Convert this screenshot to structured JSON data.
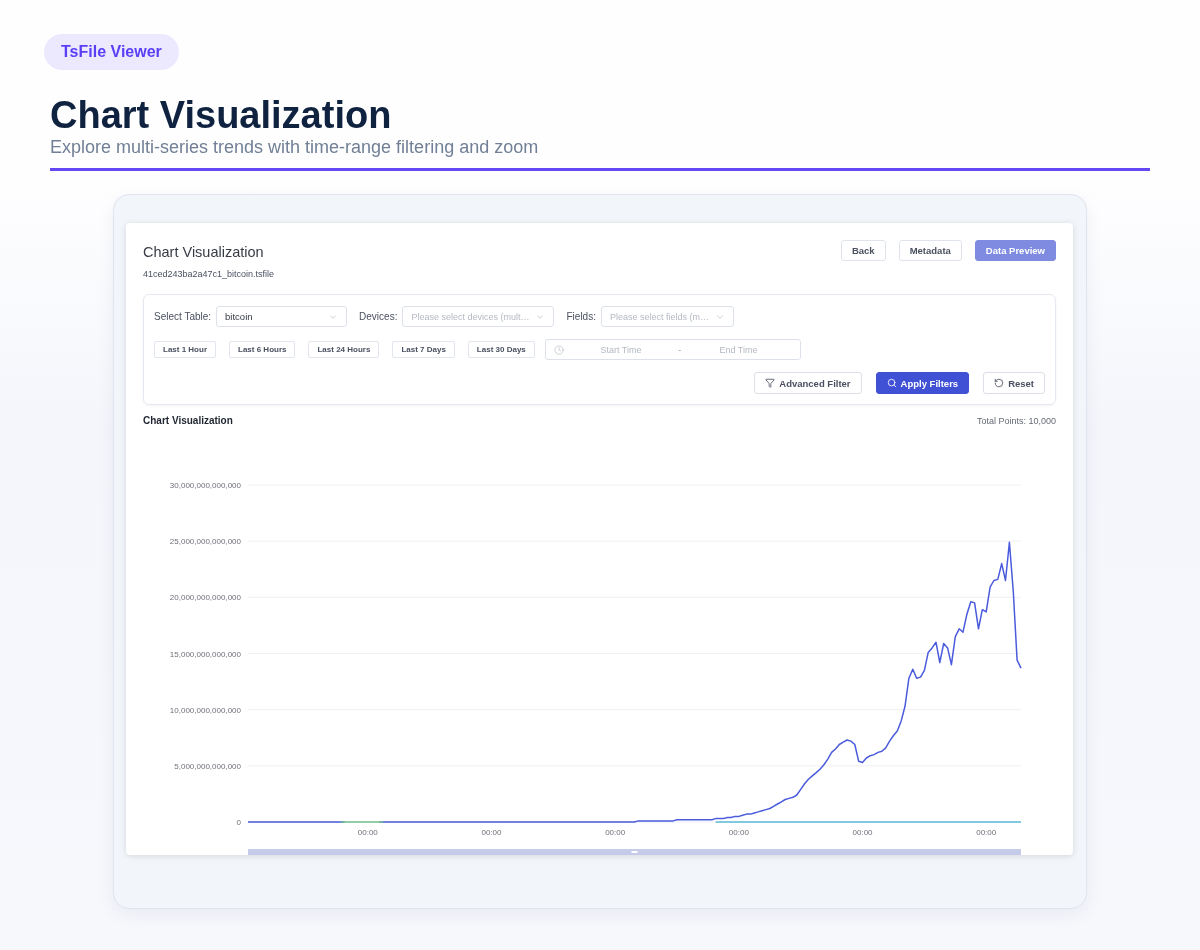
{
  "header": {
    "badge": "TsFile Viewer",
    "title": "Chart Visualization",
    "subtitle": "Explore multi-series trends with time-range filtering and zoom"
  },
  "card": {
    "title": "Chart Visualization",
    "file_name": "41ced243ba2a47c1_bitcoin.tsfile",
    "buttons": [
      {
        "label": "Back",
        "kind": "default"
      },
      {
        "label": "Metadata",
        "kind": "default"
      },
      {
        "label": "Data Preview",
        "kind": "accent"
      }
    ]
  },
  "filters": {
    "selects": [
      {
        "label": "Select Table:",
        "value": "bitcoin"
      },
      {
        "label": "Devices:",
        "placeholder": "Please select devices (mult…"
      },
      {
        "label": "Fields:",
        "placeholder": "Please select fields (m…"
      }
    ],
    "quick_ranges": [
      "Last 1 Hour",
      "Last 6 Hours",
      "Last 24 Hours",
      "Last 7 Days",
      "Last 30 Days"
    ],
    "time_range": {
      "start_placeholder": "Start Time",
      "separator": "-",
      "end_placeholder": "End Time"
    },
    "actions": [
      {
        "label": "Advanced Filter",
        "kind": "filter"
      },
      {
        "label": "Apply Filters",
        "kind": "apply"
      },
      {
        "label": "Reset",
        "kind": "reset"
      }
    ]
  },
  "chart": {
    "heading": "Chart Visualization",
    "total_points": "Total Points: 10,000",
    "chart_data": {
      "type": "line",
      "grid": true,
      "ylim": [
        0,
        30000000000000.0
      ],
      "categories": [
        null,
        null,
        null,
        null,
        null,
        null,
        null,
        null,
        null,
        null,
        null,
        null,
        null,
        null,
        null,
        null,
        null,
        null,
        null,
        null,
        null,
        null,
        null,
        null,
        null,
        null,
        null,
        null,
        null,
        null,
        null,
        "00:00",
        null,
        null,
        null,
        null,
        null,
        null,
        null,
        null,
        null,
        null,
        null,
        null,
        null,
        null,
        null,
        null,
        null,
        null,
        null,
        null,
        null,
        null,
        null,
        null,
        null,
        null,
        null,
        null,
        null,
        null,
        null,
        "00:00",
        null,
        null,
        null,
        null,
        null,
        null,
        null,
        null,
        null,
        null,
        null,
        null,
        null,
        null,
        null,
        null,
        null,
        null,
        null,
        null,
        null,
        null,
        null,
        null,
        null,
        null,
        null,
        null,
        null,
        null,
        null,
        "00:00",
        null,
        null,
        null,
        null,
        null,
        null,
        null,
        null,
        null,
        null,
        null,
        null,
        null,
        null,
        null,
        null,
        null,
        null,
        null,
        null,
        null,
        null,
        null,
        null,
        null,
        null,
        null,
        null,
        null,
        null,
        null,
        "00:00",
        null,
        null,
        null,
        null,
        null,
        null,
        null,
        null,
        null,
        null,
        null,
        null,
        null,
        null,
        null,
        null,
        null,
        null,
        null,
        null,
        null,
        null,
        null,
        null,
        null,
        null,
        null,
        null,
        null,
        null,
        null,
        "00:00",
        null,
        null,
        null,
        null,
        null,
        null,
        null,
        null,
        null,
        null,
        null,
        null,
        null,
        null,
        null,
        null,
        null,
        null,
        null,
        null,
        null,
        null,
        null,
        null,
        null,
        null,
        null,
        null,
        null,
        null,
        null,
        "00:00",
        null,
        null,
        null,
        null,
        null,
        null,
        null,
        null,
        null
      ],
      "yticks": [
        {
          "value": 0,
          "label": "0"
        },
        {
          "value": 5000000000000.0,
          "label": "5,000,000,000,000"
        },
        {
          "value": 10000000000000.0,
          "label": "10,000,000,000,000"
        },
        {
          "value": 15000000000000.0,
          "label": "15,000,000,000,000"
        },
        {
          "value": 20000000000000.0,
          "label": "20,000,000,000,000"
        },
        {
          "value": 25000000000000.0,
          "label": "25,000,000,000,000"
        },
        {
          "value": 30000000000000.0,
          "label": "30,000,000,000,000"
        }
      ],
      "series": [
        {
          "color": "#5bb8d6",
          "values": [
            null,
            null,
            null,
            null,
            null,
            null,
            null,
            null,
            null,
            null,
            null,
            null,
            null,
            null,
            null,
            null,
            null,
            null,
            null,
            null,
            null,
            null,
            null,
            null,
            null,
            null,
            null,
            null,
            null,
            null,
            null,
            null,
            null,
            null,
            null,
            null,
            null,
            null,
            null,
            null,
            null,
            null,
            null,
            null,
            null,
            null,
            null,
            null,
            null,
            null,
            null,
            null,
            null,
            null,
            null,
            null,
            null,
            null,
            null,
            null,
            null,
            null,
            null,
            null,
            null,
            null,
            null,
            null,
            null,
            null,
            null,
            null,
            null,
            null,
            null,
            null,
            null,
            null,
            null,
            null,
            null,
            null,
            null,
            null,
            null,
            null,
            null,
            null,
            null,
            null,
            null,
            null,
            null,
            null,
            null,
            null,
            null,
            null,
            null,
            null,
            null,
            null,
            null,
            null,
            null,
            null,
            null,
            null,
            null,
            null,
            null,
            null,
            null,
            null,
            null,
            null,
            null,
            null,
            null,
            null,
            null,
            0,
            0,
            0,
            0,
            0,
            0,
            0,
            0,
            0,
            0,
            0,
            0,
            0,
            0,
            0,
            0,
            0,
            0,
            0,
            0,
            0,
            0,
            0,
            0,
            0,
            0,
            0,
            0,
            0,
            0,
            0,
            0,
            0,
            0,
            0,
            0,
            0,
            0,
            0,
            0,
            0,
            0,
            0,
            0,
            0,
            0,
            0,
            0,
            0,
            0,
            0,
            0,
            0,
            0,
            0,
            0,
            0,
            0,
            0,
            0,
            0,
            0,
            0,
            0,
            0,
            0,
            0,
            0,
            0,
            0,
            0,
            0,
            0,
            0,
            0,
            0,
            0,
            0,
            0,
            0
          ]
        },
        {
          "color": "#4a5bdc",
          "values": [
            0,
            0,
            0,
            0,
            0,
            0,
            0,
            0,
            0,
            0,
            0,
            0,
            0,
            0,
            0,
            0,
            0,
            0,
            0,
            0,
            0,
            0,
            0,
            0,
            0,
            0,
            null,
            null,
            null,
            null,
            null,
            null,
            null,
            null,
            0,
            0,
            0,
            0,
            0,
            0,
            0,
            0,
            0,
            0,
            0,
            0,
            0,
            0,
            0,
            0,
            0,
            0,
            0,
            0,
            0,
            0,
            0,
            0,
            0,
            0,
            0,
            0,
            0,
            0,
            0,
            0,
            0,
            0,
            0,
            0,
            0,
            0,
            0,
            0,
            0,
            0,
            0,
            0,
            0,
            0,
            0,
            0,
            0,
            0,
            0,
            0,
            0,
            0,
            0,
            0,
            0,
            0,
            0,
            0,
            0,
            0,
            0,
            0,
            0,
            0,
            0,
            100000000000.0,
            100000000000.0,
            100000000000.0,
            100000000000.0,
            100000000000.0,
            100000000000.0,
            100000000000.0,
            100000000000.0,
            100000000000.0,
            100000000000.0,
            200000000000.0,
            200000000000.0,
            200000000000.0,
            200000000000.0,
            200000000000.0,
            200000000000.0,
            200000000000.0,
            200000000000.0,
            200000000000.0,
            200000000000.0,
            300000000000.0,
            300000000000.0,
            300000000000.0,
            400000000000.0,
            400000000000.0,
            500000000000.0,
            500000000000.0,
            600000000000.0,
            700000000000.0,
            700000000000.0,
            800000000000.0,
            900000000000.0,
            1000000000000.0,
            1100000000000.0,
            1200000000000.0,
            1400000000000.0,
            1600000000000.0,
            1800000000000.0,
            2000000000000.0,
            2100000000000.0,
            2200000000000.0,
            2400000000000.0,
            2900000000000.0,
            3400000000000.0,
            3800000000000.0,
            4100000000000.0,
            4400000000000.0,
            4700000000000.0,
            5100000000000.0,
            5600000000000.0,
            6200000000000.0,
            6500000000000.0,
            6900000000000.0,
            7100000000000.0,
            7300000000000.0,
            7200000000000.0,
            6900000000000.0,
            5400000000000.0,
            5300000000000.0,
            5700000000000.0,
            5900000000000.0,
            6000000000000.0,
            6200000000000.0,
            6300000000000.0,
            6600000000000.0,
            7200000000000.0,
            7700000000000.0,
            8100000000000.0,
            9000000000000.0,
            10300000000000.0,
            12800000000000.0,
            13600000000000.0,
            12800000000000.0,
            12900000000000.0,
            13500000000000.0,
            15100000000000.0,
            15500000000000.0,
            16000000000000.0,
            14200000000000.0,
            15900000000000.0,
            15500000000000.0,
            14000000000000.0,
            16500000000000.0,
            17200000000000.0,
            16900000000000.0,
            18500000000000.0,
            19600000000000.0,
            19500000000000.0,
            17200000000000.0,
            18900000000000.0,
            18700000000000.0,
            20900000000000.0,
            21500000000000.0,
            21600000000000.0,
            23000000000000.0,
            21500000000000.0,
            24900000000000.0,
            20500000000000.0,
            14400000000000.0,
            13700000000000.0
          ]
        },
        {
          "color": "#6cc08b",
          "values": [
            null,
            null,
            null,
            null,
            null,
            null,
            null,
            null,
            null,
            null,
            null,
            null,
            null,
            null,
            null,
            null,
            null,
            null,
            null,
            null,
            null,
            null,
            null,
            null,
            0,
            0,
            0,
            0,
            0,
            0,
            0,
            0,
            0,
            0,
            0,
            0,
            null,
            null,
            null,
            null,
            null,
            null,
            null,
            null,
            null,
            null,
            null,
            null,
            null,
            null,
            null,
            null,
            null,
            null,
            null,
            null,
            null,
            null,
            null,
            null,
            null,
            null,
            null,
            null,
            null,
            null,
            null,
            null,
            null,
            null,
            null,
            null,
            null,
            null,
            null,
            null,
            null,
            null,
            null,
            null,
            null,
            null,
            null,
            null,
            null,
            null,
            null,
            null,
            null,
            null,
            null,
            null,
            null,
            null,
            null,
            null,
            null,
            null,
            null,
            null,
            null,
            null,
            null,
            null,
            null,
            null,
            null,
            null,
            null,
            null,
            null,
            null,
            null,
            null,
            null,
            null,
            null,
            null,
            null,
            null,
            null,
            null,
            null,
            null,
            null,
            null,
            null,
            null,
            null,
            null,
            null,
            null,
            null,
            null,
            null,
            null,
            null,
            null,
            null,
            null,
            null,
            null,
            null,
            null,
            null,
            null,
            null,
            null,
            null,
            null,
            null,
            null,
            null,
            null,
            null,
            null,
            null,
            null,
            null,
            null,
            null,
            null,
            null,
            null,
            null,
            null,
            null,
            null,
            null,
            null,
            null,
            null,
            null,
            null,
            null,
            null,
            null,
            null,
            null,
            null,
            null,
            null,
            null,
            null,
            null,
            null,
            null,
            null,
            null,
            null,
            null,
            null,
            null,
            null,
            null,
            null,
            null,
            null,
            null,
            null,
            null
          ]
        }
      ]
    }
  }
}
